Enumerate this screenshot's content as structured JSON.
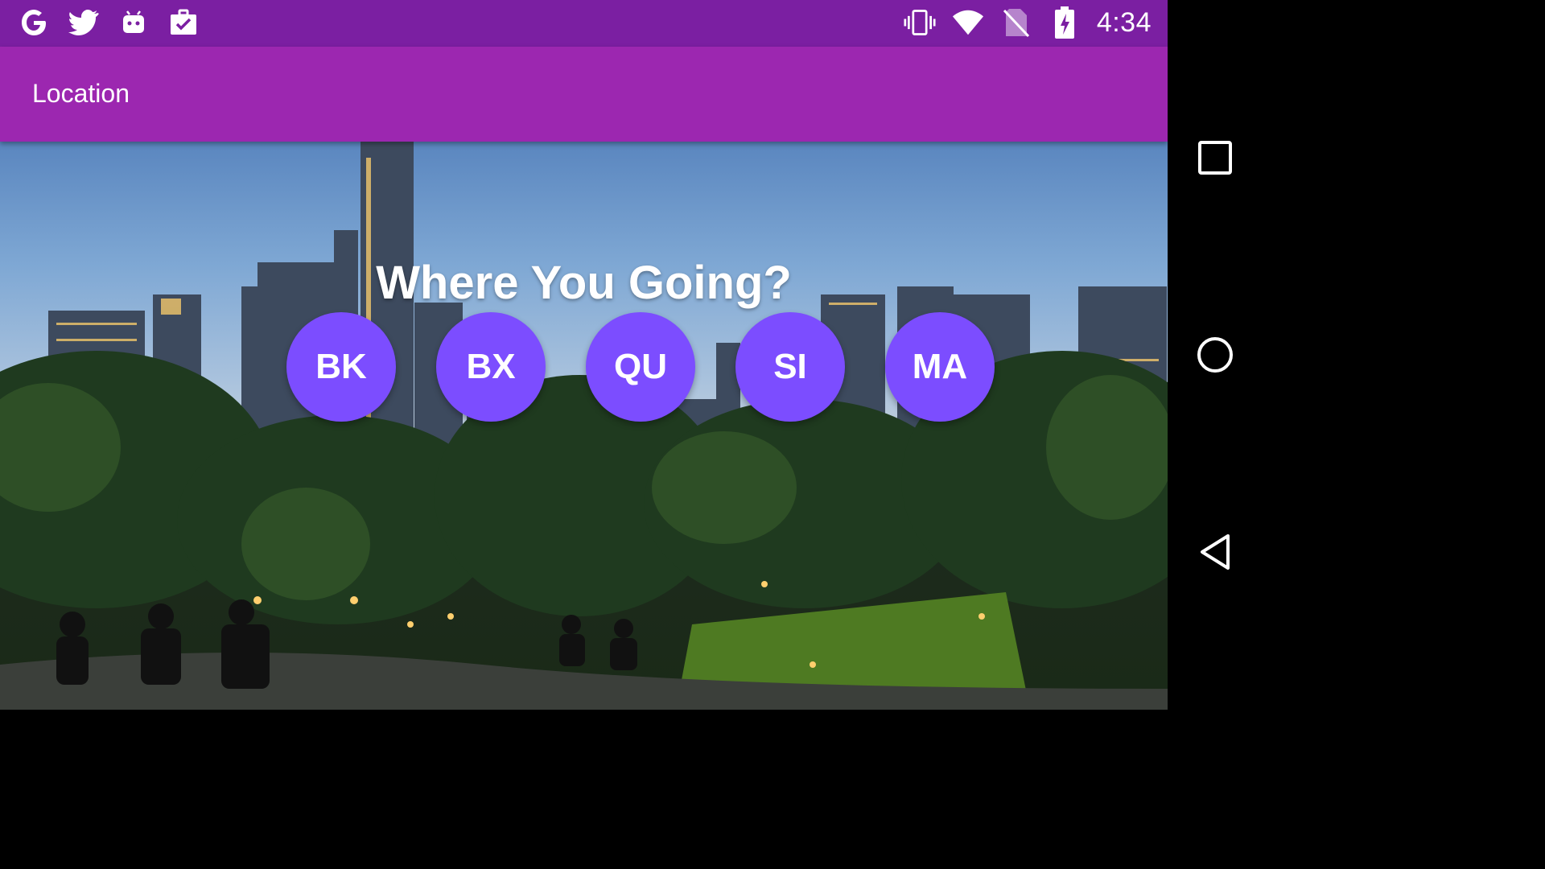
{
  "status_bar": {
    "time": "4:34",
    "left_icons": [
      "google-g-icon",
      "twitter-icon",
      "android-robot-icon",
      "briefcase-check-icon"
    ],
    "right_icons": [
      "vibrate-icon",
      "wifi-icon",
      "no-sim-icon",
      "battery-charging-icon"
    ],
    "background": "#7B1FA2"
  },
  "app_bar": {
    "title": "Location",
    "background": "#9C27B0"
  },
  "main": {
    "heading": "Where You Going?",
    "boroughs": [
      {
        "label": "BK"
      },
      {
        "label": "BX"
      },
      {
        "label": "QU"
      },
      {
        "label": "SI"
      },
      {
        "label": "MA"
      }
    ],
    "button_color": "#7C4DFF"
  },
  "nav_bar": {
    "buttons": [
      "recents-square-icon",
      "home-circle-icon",
      "back-triangle-icon"
    ]
  }
}
